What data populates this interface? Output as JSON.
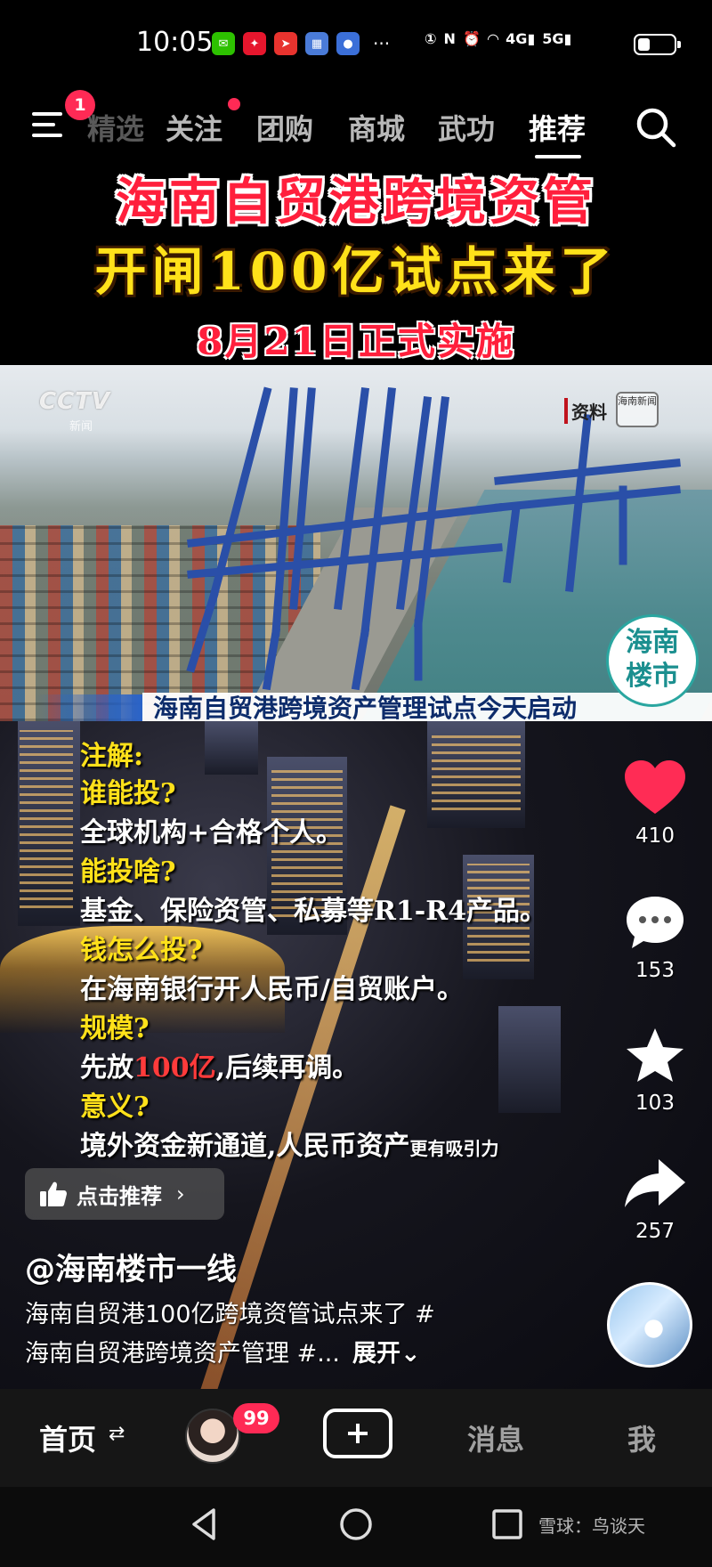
{
  "status_bar": {
    "time": "10:05",
    "notification_icons": [
      {
        "name": "wechat-icon",
        "color": "#2dc100"
      },
      {
        "name": "weibo-icon",
        "color": "#e6162d"
      },
      {
        "name": "app-red-icon",
        "color": "#e8332e"
      },
      {
        "name": "app-blue-icon",
        "color": "#4a7bd8"
      },
      {
        "name": "qq-icon",
        "color": "#3b6fd8"
      }
    ],
    "more": "···",
    "system_icons": [
      "1",
      "N",
      "⏰",
      "6",
      "4G",
      "5G"
    ]
  },
  "top_nav": {
    "menu_badge": "1",
    "tabs": [
      {
        "label": "精选",
        "state": "faded"
      },
      {
        "label": "关注",
        "state": "normal",
        "dot": true
      },
      {
        "label": "团购",
        "state": "normal"
      },
      {
        "label": "商城",
        "state": "normal"
      },
      {
        "label": "武功",
        "state": "normal"
      },
      {
        "label": "推荐",
        "state": "active"
      }
    ]
  },
  "video": {
    "title_line1": "海南自贸港跨境资管",
    "title_line2": "开闸100亿试点来了",
    "title_line3": "8月21日正式实施",
    "clip": {
      "broadcaster": "CCTV",
      "broadcaster_sub": "新闻",
      "source_tag": "资料",
      "station_logo": "海南新闻",
      "ticker": "海南自贸港跨境资产管理试点今天启动",
      "seal_line1": "海南",
      "seal_line2": "楼市"
    },
    "notes": {
      "heading": "注解:",
      "items": [
        {
          "q": "谁能投?",
          "a": "全球机构+合格个人。"
        },
        {
          "q": "能投啥?",
          "a": "基金、保险资管、私募等R1-R4产品。"
        },
        {
          "q": "钱怎么投?",
          "a": "在海南银行开人民币/自贸账户。"
        },
        {
          "q": "规模?",
          "a_prefix": "先放",
          "a_highlight": "100亿",
          "a_suffix": ",后续再调。"
        },
        {
          "q": "意义?",
          "a_main": "境外资金新通道,人民币资产",
          "a_small": "更有吸引力"
        }
      ]
    }
  },
  "actions": {
    "like_count": "410",
    "comment_count": "153",
    "favorite_count": "103",
    "share_count": "257",
    "like_color": "#ff2c55"
  },
  "recommend_chip": {
    "label": "点击推荐",
    "chevron": "›"
  },
  "author": {
    "name": "@海南楼市一线"
  },
  "caption": {
    "line1": "海南自贸港100亿跨境资管试点来了 #",
    "line2": "海南自贸港跨境资产管理 #...",
    "expand": "展开⌄"
  },
  "bottom_nav": {
    "home": "首页",
    "home_switch": "⇄",
    "avatar_badge": "99",
    "messages": "消息",
    "me": "我"
  },
  "watermark": "雪球：鸟谈天"
}
